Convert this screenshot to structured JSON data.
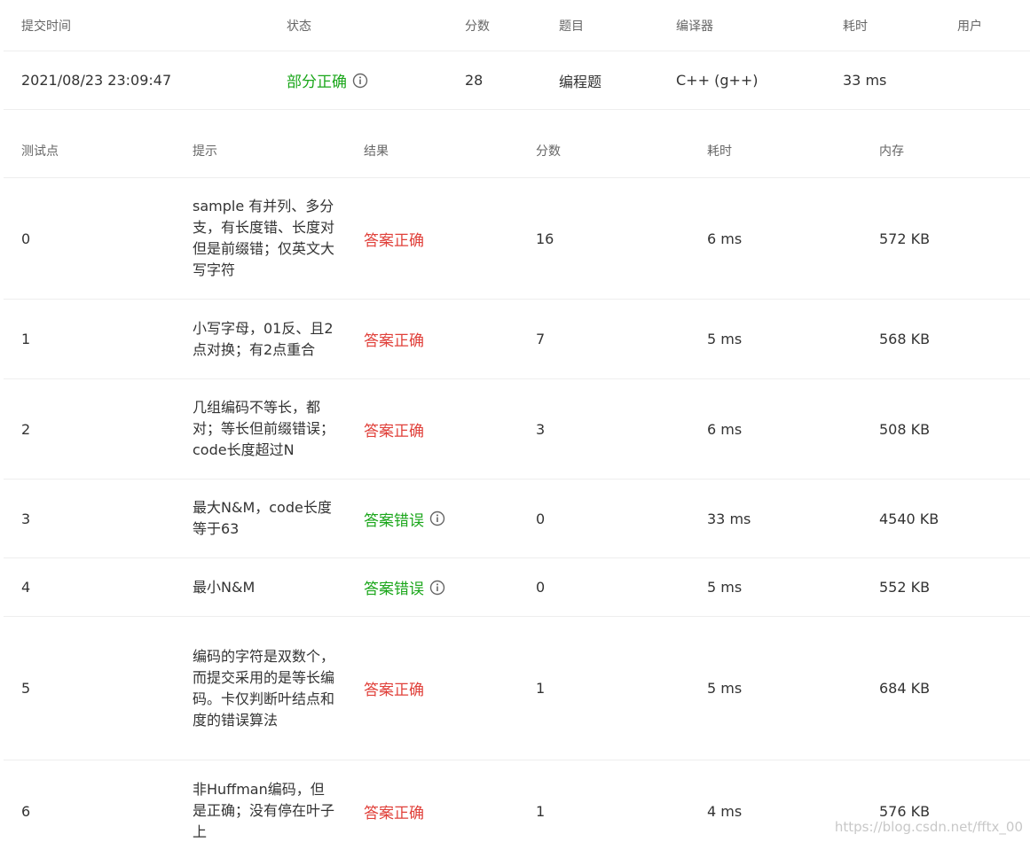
{
  "summary": {
    "headers": {
      "submit_time": "提交时间",
      "status": "状态",
      "score": "分数",
      "problem": "题目",
      "compiler": "编译器",
      "time": "耗时",
      "user": "用户"
    },
    "row": {
      "submit_time": "2021/08/23 23:09:47",
      "status": "部分正确",
      "score": "28",
      "problem": "编程题",
      "compiler": "C++ (g++)",
      "time": "33 ms",
      "user": ""
    }
  },
  "cases": {
    "headers": {
      "id": "测试点",
      "hint": "提示",
      "result": "结果",
      "score": "分数",
      "time": "耗时",
      "memory": "内存"
    },
    "rows": [
      {
        "id": "0",
        "hint": "sample 有并列、多分支，有长度错、长度对但是前缀错；仅英文大写字符",
        "result": "答案正确",
        "score": "16",
        "time": "6 ms",
        "memory": "572 KB"
      },
      {
        "id": "1",
        "hint": "小写字母，01反、且2点对换；有2点重合",
        "result": "答案正确",
        "score": "7",
        "time": "5 ms",
        "memory": "568 KB"
      },
      {
        "id": "2",
        "hint": "几组编码不等长，都对；等长但前缀错误；code长度超过N",
        "result": "答案正确",
        "score": "3",
        "time": "6 ms",
        "memory": "508 KB"
      },
      {
        "id": "3",
        "hint": "最大N&M，code长度等于63",
        "result": "答案错误",
        "score": "0",
        "time": "33 ms",
        "memory": "4540 KB"
      },
      {
        "id": "4",
        "hint": "最小N&M",
        "result": "答案错误",
        "score": "0",
        "time": "5 ms",
        "memory": "552 KB"
      },
      {
        "id": "5",
        "hint": "编码的字符是双数个，而提交采用的是等长编码。卡仅判断叶结点和度的错误算法",
        "result": "答案正确",
        "score": "1",
        "time": "5 ms",
        "memory": "684 KB"
      },
      {
        "id": "6",
        "hint": "非Huffman编码，但是正确；没有停在叶子上",
        "result": "答案正确",
        "score": "1",
        "time": "4 ms",
        "memory": "576 KB"
      }
    ]
  },
  "watermark": "https://blog.csdn.net/fftx_00",
  "colors": {
    "accepted": "#e0403a",
    "wrong_or_partial": "#1aa61a",
    "divider": "#eeeeee"
  }
}
